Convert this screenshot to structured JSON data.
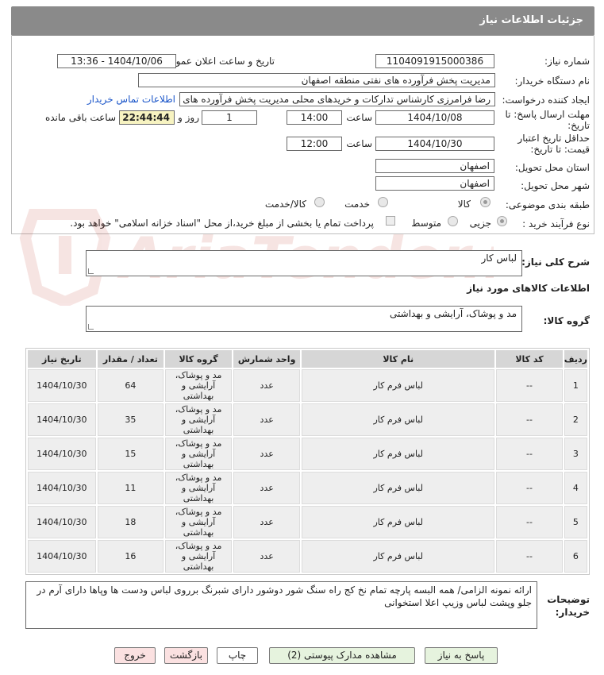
{
  "panel": {
    "title": "جزئیات اطلاعات نیاز"
  },
  "fields": {
    "need_number": {
      "label": "شماره نیاز:",
      "value": "1104091915000386"
    },
    "announce_datetime": {
      "label": "تاریخ و ساعت اعلان عمومی:",
      "value": "1404/10/06 - 13:36"
    },
    "buyer": {
      "label": "نام دستگاه خریدار:",
      "value": "مدیریت پخش فرآورده های نفتی منطقه اصفهان"
    },
    "creator": {
      "label": "ایجاد کننده درخواست:",
      "value": "رضا فرامرزی کارشناس تدارکات و خریدهای محلی مدیریت پخش فرآورده های نفتی",
      "contact_link": "اطلاعات تماس خریدار"
    },
    "deadline": {
      "label_line1": "مهلت ارسال پاسخ: تا",
      "label_line2": "تاریخ:",
      "date": "1404/10/08",
      "time_label": "ساعت",
      "time": "14:00",
      "days": "1",
      "days_label": "روز و",
      "remaining": "22:44:44",
      "remaining_label": "ساعت باقی مانده"
    },
    "validity": {
      "label_line1": "حداقل تاریخ اعتبار",
      "label_line2": "قیمت: تا تاریخ:",
      "date": "1404/10/30",
      "time_label": "ساعت",
      "time": "12:00"
    },
    "province": {
      "label": "استان محل تحویل:",
      "value": "اصفهان"
    },
    "city": {
      "label": "شهر محل تحویل:",
      "value": "اصفهان"
    },
    "category": {
      "label": "طبقه بندی موضوعی:",
      "options": [
        "کالا",
        "خدمت",
        "کالا/خدمت"
      ]
    },
    "process": {
      "label": "نوع فرآیند خرید :",
      "options": [
        "جزیی",
        "متوسط"
      ],
      "payment_note": "پرداخت تمام یا بخشی از مبلغ خرید،از محل \"اسناد خزانه اسلامی\" خواهد بود."
    }
  },
  "description": {
    "label": "شرح کلی نیاز:",
    "value": "لباس کار"
  },
  "goods_info": {
    "title": "اطلاعات کالاهای مورد نیاز"
  },
  "goods_group": {
    "label": "گروه کالا:",
    "value": "مد و پوشاک، آرایشی و بهداشتی"
  },
  "table": {
    "headers": [
      "ردیف",
      "کد کالا",
      "نام کالا",
      "واحد شمارش",
      "گروه کالا",
      "تعداد / مقدار",
      "تاریخ نیاز"
    ],
    "rows": [
      [
        "1",
        "--",
        "لباس فرم کار",
        "عدد",
        "مد و پوشاک، آرایشی و بهداشتی",
        "64",
        "1404/10/30"
      ],
      [
        "2",
        "--",
        "لباس فرم کار",
        "عدد",
        "مد و پوشاک، آرایشی و بهداشتی",
        "35",
        "1404/10/30"
      ],
      [
        "3",
        "--",
        "لباس فرم کار",
        "عدد",
        "مد و پوشاک، آرایشی و بهداشتی",
        "15",
        "1404/10/30"
      ],
      [
        "4",
        "--",
        "لباس فرم کار",
        "عدد",
        "مد و پوشاک، آرایشی و بهداشتی",
        "11",
        "1404/10/30"
      ],
      [
        "5",
        "--",
        "لباس فرم کار",
        "عدد",
        "مد و پوشاک، آرایشی و بهداشتی",
        "18",
        "1404/10/30"
      ],
      [
        "6",
        "--",
        "لباس فرم کار",
        "عدد",
        "مد و پوشاک، آرایشی و بهداشتی",
        "16",
        "1404/10/30"
      ]
    ]
  },
  "buyer_notes": {
    "label_line1": "توضیحات",
    "label_line2": "خریدار:",
    "value": "ارائه نمونه الزامی/ همه البسه پارچه تمام نخ کج راه سنگ شور دوشور دارای شبرنگ برروی لباس ودست ها وپاها دارای آرم در جلو وپشت لباس وزیپ اعلا استخوانی"
  },
  "buttons": {
    "reply": "پاسخ به نیاز",
    "attachments": "مشاهده مدارک پیوستی (2)",
    "print": "چاپ",
    "back": "بازگشت",
    "exit": "خروج"
  },
  "watermark": {
    "text": "AriaTender.net"
  },
  "colors": {
    "header": "#8a8a8a",
    "link": "#1a55c9",
    "remaining_bg": "#f7f3c1"
  }
}
